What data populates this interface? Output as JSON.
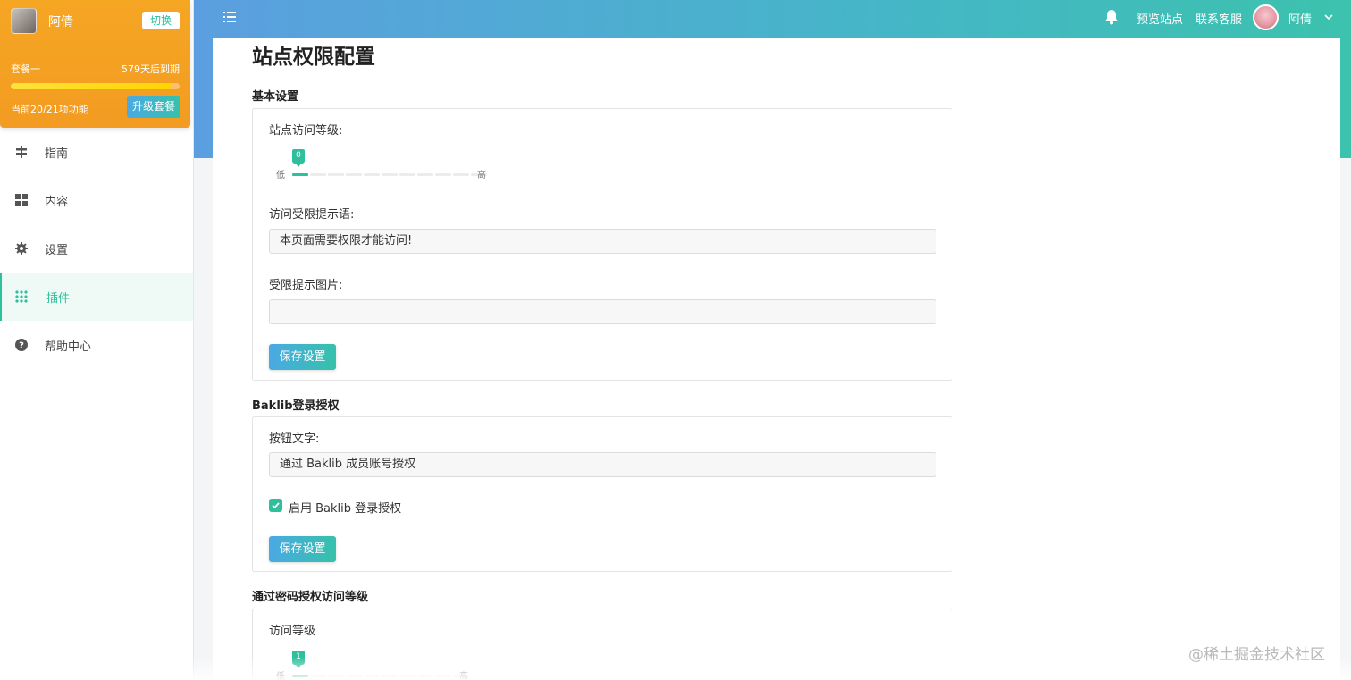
{
  "sidebar": {
    "user": {
      "name": "阿倩",
      "switch_label": "切换",
      "plan": "套餐一",
      "expire": "579天后到期",
      "usage_fraction": 0.95,
      "features": "当前20/21项功能",
      "upgrade_label": "升级套餐"
    },
    "items": [
      {
        "label": "指南",
        "icon": "signpost-icon"
      },
      {
        "label": "内容",
        "icon": "grid-icon"
      },
      {
        "label": "设置",
        "icon": "gear-icon"
      },
      {
        "label": "插件",
        "icon": "apps-dots-icon"
      },
      {
        "label": "帮助中心",
        "icon": "help-icon"
      }
    ],
    "active_index": 3
  },
  "header": {
    "preview_label": "预览站点",
    "contact_label": "联系客服",
    "user_name": "阿倩"
  },
  "page": {
    "title": "站点权限配置",
    "basic": {
      "section_title": "基本设置",
      "level_label": "站点访问等级:",
      "level_value": "0",
      "low_label": "低",
      "high_label": "高",
      "tip_label": "访问受限提示语:",
      "tip_value": "本页面需要权限才能访问!",
      "image_label": "受限提示图片:",
      "image_value": "",
      "save_label": "保存设置"
    },
    "baklib": {
      "section_title": "Baklib登录授权",
      "button_text_label": "按钮文字:",
      "button_text_value": "通过 Baklib 成员账号授权",
      "enable_label": "启用 Baklib 登录授权",
      "enabled": true,
      "save_label": "保存设置"
    },
    "password": {
      "section_title": "通过密码授权访问等级",
      "level_label": "访问等级",
      "level_value": "1",
      "low_label": "低",
      "high_label": "高"
    }
  },
  "watermark": "@稀土掘金技术社区",
  "colors": {
    "accent": "#2ebf9c",
    "user_card": "#f5a623",
    "header_start": "#5b9fe0",
    "header_end": "#3cc2ad"
  }
}
